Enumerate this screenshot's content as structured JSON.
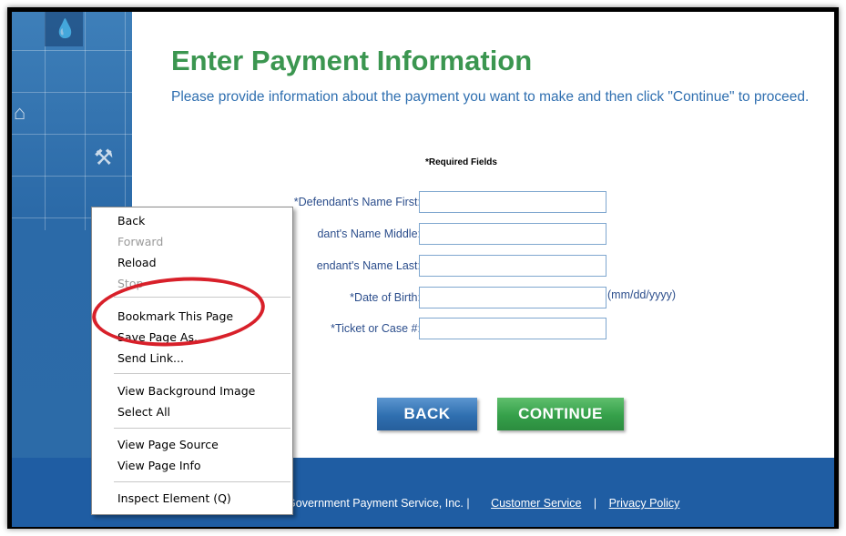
{
  "page": {
    "title": "Enter Payment Information",
    "subtitle": "Please provide information about the payment you want to make and then click \"Continue\" to proceed.",
    "required_note": "*Required Fields"
  },
  "form": {
    "fields": [
      {
        "label": "*Defendant's Name First:",
        "value": ""
      },
      {
        "label": "dant's Name Middle:",
        "value": ""
      },
      {
        "label": "endant's Name Last:",
        "value": ""
      },
      {
        "label": "*Date of Birth:",
        "value": "",
        "hint": "(mm/dd/yyyy)"
      },
      {
        "label": "*Ticket or Case #:",
        "value": ""
      }
    ],
    "back_label": "BACK",
    "continue_label": "CONTINUE"
  },
  "footer": {
    "copyright": "© 2011 Government Payment Service, Inc. |",
    "customer_service": "Customer Service",
    "separator": "|",
    "privacy": "Privacy Policy"
  },
  "context_menu": {
    "items": [
      {
        "label": "Back",
        "disabled": false
      },
      {
        "label": "Forward",
        "disabled": true
      },
      {
        "label": "Reload",
        "disabled": false
      },
      {
        "label": "Stop",
        "disabled": true
      },
      {
        "label": "Bookmark This Page",
        "disabled": false
      },
      {
        "label": "Save Page As...",
        "disabled": false
      },
      {
        "label": "Send Link...",
        "disabled": false
      },
      {
        "label": "View Background Image",
        "disabled": false
      },
      {
        "label": "Select All",
        "disabled": false
      },
      {
        "label": "View Page Source",
        "disabled": false
      },
      {
        "label": "View Page Info",
        "disabled": false
      },
      {
        "label": "Inspect Element (Q)",
        "disabled": false
      }
    ]
  },
  "colors": {
    "title_green": "#3b9650",
    "link_blue": "#2f6fb0",
    "footer_blue": "#1f5da3",
    "continue_green": "#35a04a",
    "back_blue": "#2f6fb0",
    "annotation_red": "#d8202a"
  }
}
